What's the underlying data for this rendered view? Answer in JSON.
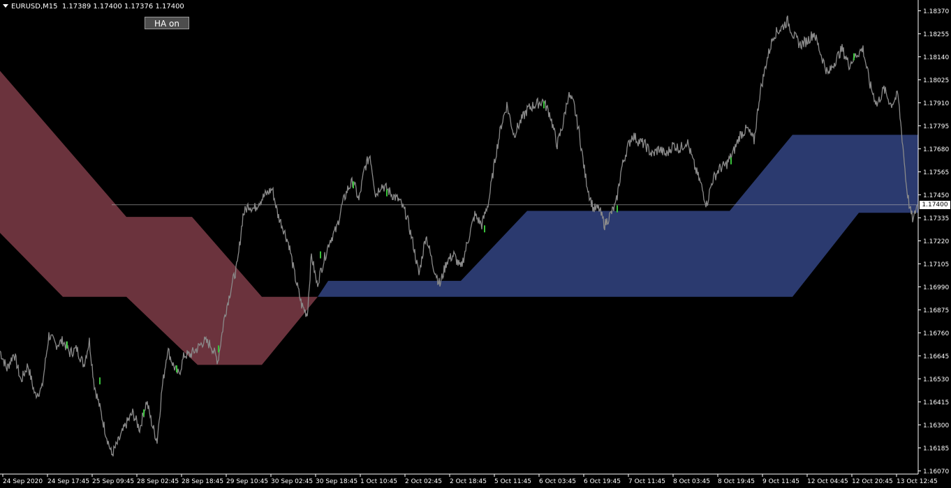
{
  "header": {
    "symbol": "EURUSD,M15",
    "ohlc": "1.17389 1.17400 1.17376 1.17400"
  },
  "toolbar": {
    "ha_button": "HA on"
  },
  "current_price": "1.17400",
  "colors": {
    "background": "#000000",
    "candles": "#8a8a8a",
    "bull_accent": "#39c33a",
    "bear_cloud": "#6b333d",
    "bull_cloud": "#2b3a6f",
    "price_line": "#b0b0b0",
    "axis": "#ffffff"
  },
  "chart_data": {
    "type": "line",
    "y_ticks": [
      "1.18370",
      "1.18255",
      "1.18140",
      "1.18025",
      "1.17910",
      "1.17795",
      "1.17680",
      "1.17565",
      "1.17450",
      "1.17335",
      "1.17220",
      "1.17105",
      "1.16990",
      "1.16875",
      "1.16760",
      "1.16645",
      "1.16530",
      "1.16415",
      "1.16300",
      "1.16185",
      "1.16070"
    ],
    "ylim": [
      1.1607,
      1.184
    ],
    "x_labels": [
      "24 Sep 2020",
      "24 Sep 17:45",
      "25 Sep 09:45",
      "28 Sep 02:45",
      "28 Sep 18:45",
      "29 Sep 10:45",
      "30 Sep 02:45",
      "30 Sep 18:45",
      "1 Oct 10:45",
      "2 Oct 02:45",
      "2 Oct 18:45",
      "5 Oct 11:45",
      "6 Oct 03:45",
      "6 Oct 19:45",
      "7 Oct 11:45",
      "8 Oct 03:45",
      "8 Oct 19:45",
      "9 Oct 11:45",
      "12 Oct 04:45",
      "12 Oct 20:45",
      "13 Oct 12:45"
    ],
    "price_path": [
      [
        0,
        1.1667
      ],
      [
        10,
        1.1658
      ],
      [
        20,
        1.1666
      ],
      [
        30,
        1.1652
      ],
      [
        40,
        1.166
      ],
      [
        50,
        1.1645
      ],
      [
        60,
        1.1648
      ],
      [
        70,
        1.1675
      ],
      [
        80,
        1.167
      ],
      [
        90,
        1.1672
      ],
      [
        100,
        1.1666
      ],
      [
        110,
        1.1668
      ],
      [
        120,
        1.166
      ],
      [
        128,
        1.1672
      ],
      [
        135,
        1.165
      ],
      [
        142,
        1.164
      ],
      [
        150,
        1.1628
      ],
      [
        160,
        1.1615
      ],
      [
        170,
        1.1622
      ],
      [
        180,
        1.163
      ],
      [
        190,
        1.1636
      ],
      [
        200,
        1.1628
      ],
      [
        210,
        1.1642
      ],
      [
        218,
        1.163
      ],
      [
        225,
        1.1622
      ],
      [
        232,
        1.1648
      ],
      [
        240,
        1.1668
      ],
      [
        248,
        1.166
      ],
      [
        256,
        1.1655
      ],
      [
        264,
        1.1665
      ],
      [
        272,
        1.1665
      ],
      [
        282,
        1.1668
      ],
      [
        292,
        1.1672
      ],
      [
        302,
        1.167
      ],
      [
        312,
        1.1662
      ],
      [
        322,
        1.1685
      ],
      [
        332,
        1.17
      ],
      [
        340,
        1.171
      ],
      [
        348,
        1.1735
      ],
      [
        356,
        1.174
      ],
      [
        364,
        1.1738
      ],
      [
        372,
        1.1742
      ],
      [
        380,
        1.1745
      ],
      [
        390,
        1.1748
      ],
      [
        398,
        1.1735
      ],
      [
        406,
        1.1728
      ],
      [
        414,
        1.172
      ],
      [
        422,
        1.1705
      ],
      [
        432,
        1.169
      ],
      [
        440,
        1.1685
      ],
      [
        446,
        1.1715
      ],
      [
        454,
        1.17
      ],
      [
        462,
        1.171
      ],
      [
        472,
        1.1722
      ],
      [
        482,
        1.1728
      ],
      [
        490,
        1.174
      ],
      [
        498,
        1.1748
      ],
      [
        506,
        1.1752
      ],
      [
        514,
        1.1742
      ],
      [
        522,
        1.1758
      ],
      [
        530,
        1.1765
      ],
      [
        538,
        1.1745
      ],
      [
        546,
        1.175
      ],
      [
        554,
        1.1748
      ],
      [
        562,
        1.1745
      ],
      [
        572,
        1.1742
      ],
      [
        582,
        1.1735
      ],
      [
        592,
        1.172
      ],
      [
        600,
        1.1705
      ],
      [
        610,
        1.1725
      ],
      [
        620,
        1.171
      ],
      [
        630,
        1.17
      ],
      [
        640,
        1.1712
      ],
      [
        650,
        1.1715
      ],
      [
        660,
        1.1708
      ],
      [
        670,
        1.1722
      ],
      [
        680,
        1.1735
      ],
      [
        690,
        1.173
      ],
      [
        700,
        1.1742
      ],
      [
        710,
        1.1765
      ],
      [
        718,
        1.178
      ],
      [
        726,
        1.179
      ],
      [
        736,
        1.1775
      ],
      [
        746,
        1.1782
      ],
      [
        756,
        1.1788
      ],
      [
        766,
        1.179
      ],
      [
        778,
        1.1792
      ],
      [
        788,
        1.1785
      ],
      [
        798,
        1.177
      ],
      [
        806,
        1.178
      ],
      [
        814,
        1.1795
      ],
      [
        822,
        1.179
      ],
      [
        830,
        1.1775
      ],
      [
        838,
        1.1755
      ],
      [
        844,
        1.1745
      ],
      [
        850,
        1.1738
      ],
      [
        858,
        1.1738
      ],
      [
        866,
        1.173
      ],
      [
        874,
        1.1735
      ],
      [
        882,
        1.174
      ],
      [
        890,
        1.1758
      ],
      [
        898,
        1.1768
      ],
      [
        906,
        1.1775
      ],
      [
        914,
        1.1772
      ],
      [
        924,
        1.177
      ],
      [
        934,
        1.1765
      ],
      [
        944,
        1.1768
      ],
      [
        954,
        1.1765
      ],
      [
        964,
        1.177
      ],
      [
        974,
        1.1768
      ],
      [
        984,
        1.1772
      ],
      [
        994,
        1.176
      ],
      [
        1004,
        1.175
      ],
      [
        1012,
        1.174
      ],
      [
        1020,
        1.1752
      ],
      [
        1030,
        1.1758
      ],
      [
        1040,
        1.176
      ],
      [
        1050,
        1.1766
      ],
      [
        1060,
        1.1775
      ],
      [
        1070,
        1.1778
      ],
      [
        1080,
        1.1772
      ],
      [
        1088,
        1.1795
      ],
      [
        1098,
        1.1812
      ],
      [
        1108,
        1.1825
      ],
      [
        1118,
        1.1828
      ],
      [
        1128,
        1.1832
      ],
      [
        1136,
        1.1825
      ],
      [
        1146,
        1.182
      ],
      [
        1156,
        1.1822
      ],
      [
        1166,
        1.1826
      ],
      [
        1176,
        1.1815
      ],
      [
        1186,
        1.1805
      ],
      [
        1196,
        1.1812
      ],
      [
        1206,
        1.1818
      ],
      [
        1216,
        1.181
      ],
      [
        1226,
        1.1815
      ],
      [
        1236,
        1.1818
      ],
      [
        1246,
        1.18
      ],
      [
        1256,
        1.179
      ],
      [
        1266,
        1.1798
      ],
      [
        1276,
        1.179
      ],
      [
        1286,
        1.1795
      ],
      [
        1293,
        1.177
      ],
      [
        1298,
        1.175
      ],
      [
        1303,
        1.1738
      ],
      [
        1308,
        1.1732
      ],
      [
        1313,
        1.174
      ]
    ],
    "bear_cloud": {
      "upper": [
        [
          0,
          1.1807
        ],
        [
          181,
          1.1734
        ],
        [
          275,
          1.1734
        ],
        [
          375,
          1.1694
        ],
        [
          455,
          1.1694
        ]
      ],
      "lower": [
        [
          0,
          1.1726
        ],
        [
          90,
          1.1694
        ],
        [
          181,
          1.1694
        ],
        [
          283,
          1.166
        ],
        [
          375,
          1.166
        ],
        [
          455,
          1.1694
        ]
      ]
    },
    "bull_cloud": {
      "upper": [
        [
          455,
          1.1694
        ],
        [
          470,
          1.1702
        ],
        [
          660,
          1.1702
        ],
        [
          755,
          1.1737
        ],
        [
          1045,
          1.1737
        ],
        [
          1135,
          1.1775
        ],
        [
          1315,
          1.1775
        ]
      ],
      "lower": [
        [
          455,
          1.1694
        ],
        [
          1135,
          1.1694
        ],
        [
          1230,
          1.1736
        ],
        [
          1315,
          1.1736
        ]
      ]
    },
    "current_price": 1.174
  }
}
